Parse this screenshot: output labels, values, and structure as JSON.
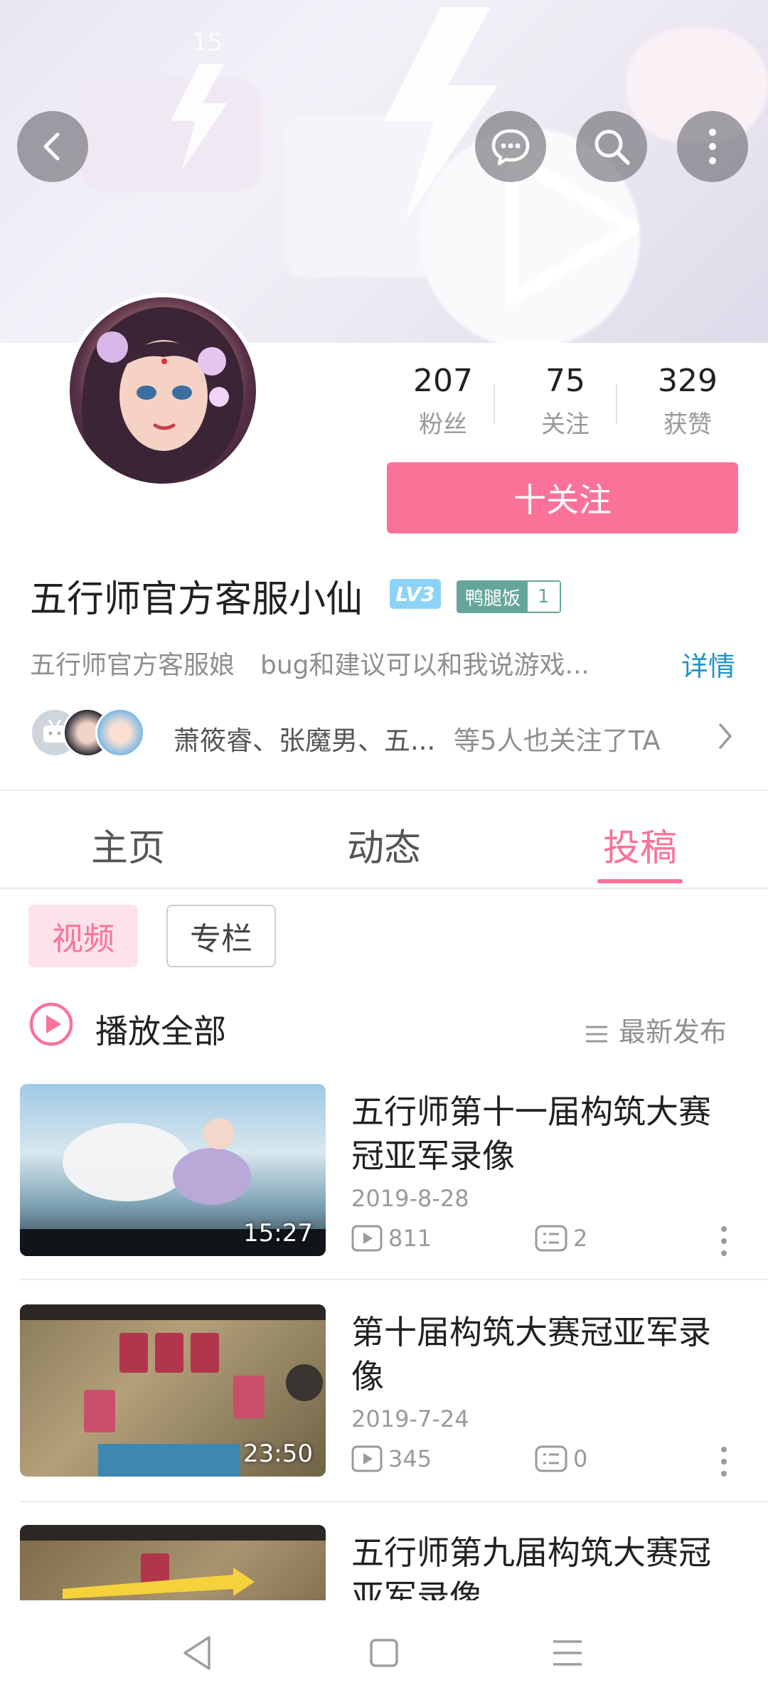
{
  "status_bar": {
    "time": "15"
  },
  "header": {
    "back_icon": "chevron-left-icon",
    "message_icon": "chat-bubble-icon",
    "search_icon": "search-icon",
    "more_icon": "more-vertical-icon"
  },
  "profile": {
    "stats": [
      {
        "value": "207",
        "label": "粉丝"
      },
      {
        "value": "75",
        "label": "关注"
      },
      {
        "value": "329",
        "label": "获赞"
      }
    ],
    "follow_label": "十关注",
    "username": "五行师官方客服小仙",
    "level": "LV3",
    "medal_name": "鸭腿饭",
    "medal_level": "1",
    "signature": "五行师官方客服娘　bug和建议可以和我说游戏...",
    "detail_label": "详情",
    "mutual_names": "萧筱睿、张魔男、五...",
    "mutual_suffix": "等5人也关注了TA"
  },
  "tabs": [
    {
      "label": "主页",
      "active": false
    },
    {
      "label": "动态",
      "active": false
    },
    {
      "label": "投稿",
      "active": true
    }
  ],
  "chips": {
    "video": "视频",
    "column": "专栏"
  },
  "list_header": {
    "play_all": "播放全部",
    "sort": "最新发布"
  },
  "videos": [
    {
      "title": "五行师第十一届构筑大赛冠亚军录像",
      "date": "2019-8-28",
      "duration": "15:27",
      "plays": "811",
      "comments": "2"
    },
    {
      "title": "第十届构筑大赛冠亚军录像",
      "date": "2019-7-24",
      "duration": "23:50",
      "plays": "345",
      "comments": "0"
    },
    {
      "title": "五行师第九届构筑大赛冠亚军录像",
      "date": "",
      "duration": "",
      "plays": "",
      "comments": ""
    }
  ],
  "colors": {
    "accent": "#fb7299",
    "link": "#1e94c8",
    "medal": "#66a69a"
  }
}
